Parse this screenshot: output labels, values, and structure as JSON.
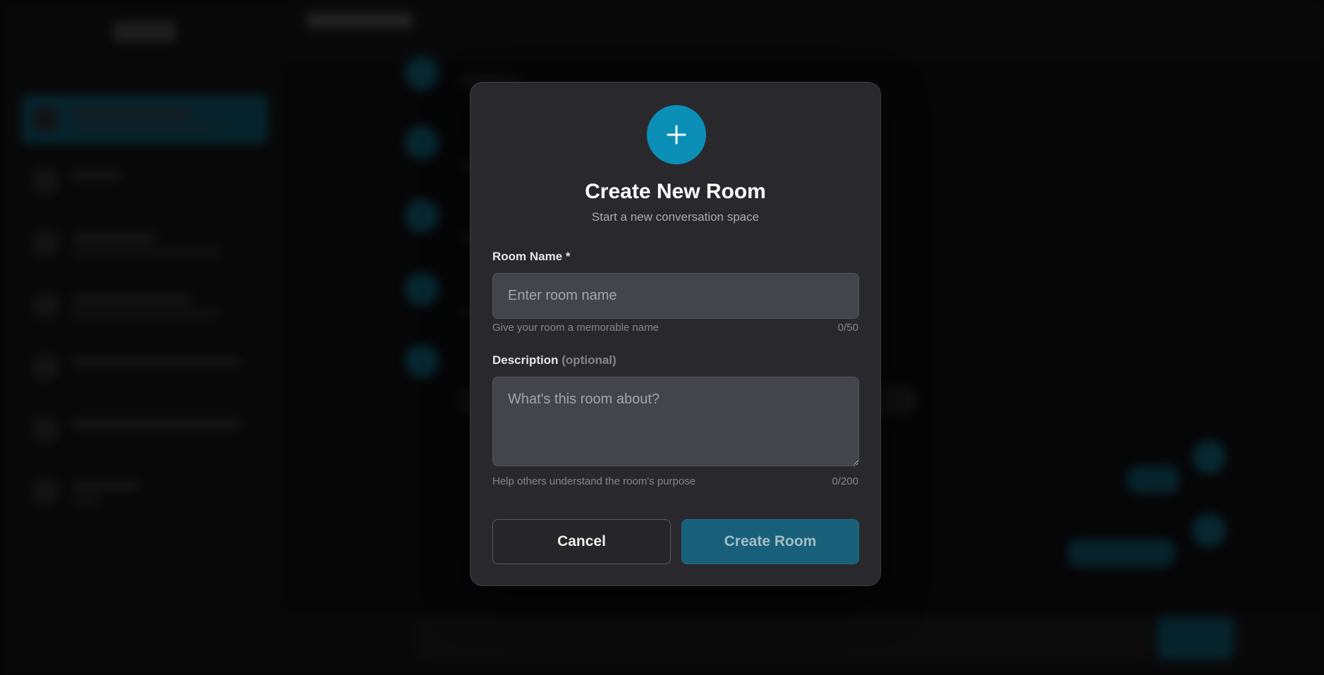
{
  "modal": {
    "icon": "plus-icon",
    "title": "Create New Room",
    "subtitle": "Start a new conversation space",
    "room_name": {
      "label": "Room Name *",
      "placeholder": "Enter room name",
      "value": "",
      "hint": "Give your room a memorable name",
      "counter": "0/50"
    },
    "description": {
      "label": "Description",
      "label_suffix": "(optional)",
      "placeholder": "What's this room about?",
      "value": "",
      "hint": "Help others understand the room's purpose",
      "counter": "0/200"
    },
    "buttons": {
      "cancel": "Cancel",
      "create": "Create Room"
    }
  },
  "colors": {
    "accent": "#0b8fb7",
    "create_button_disabled": "#18607a",
    "modal_bg": "#29292d",
    "input_bg": "#44444c"
  }
}
